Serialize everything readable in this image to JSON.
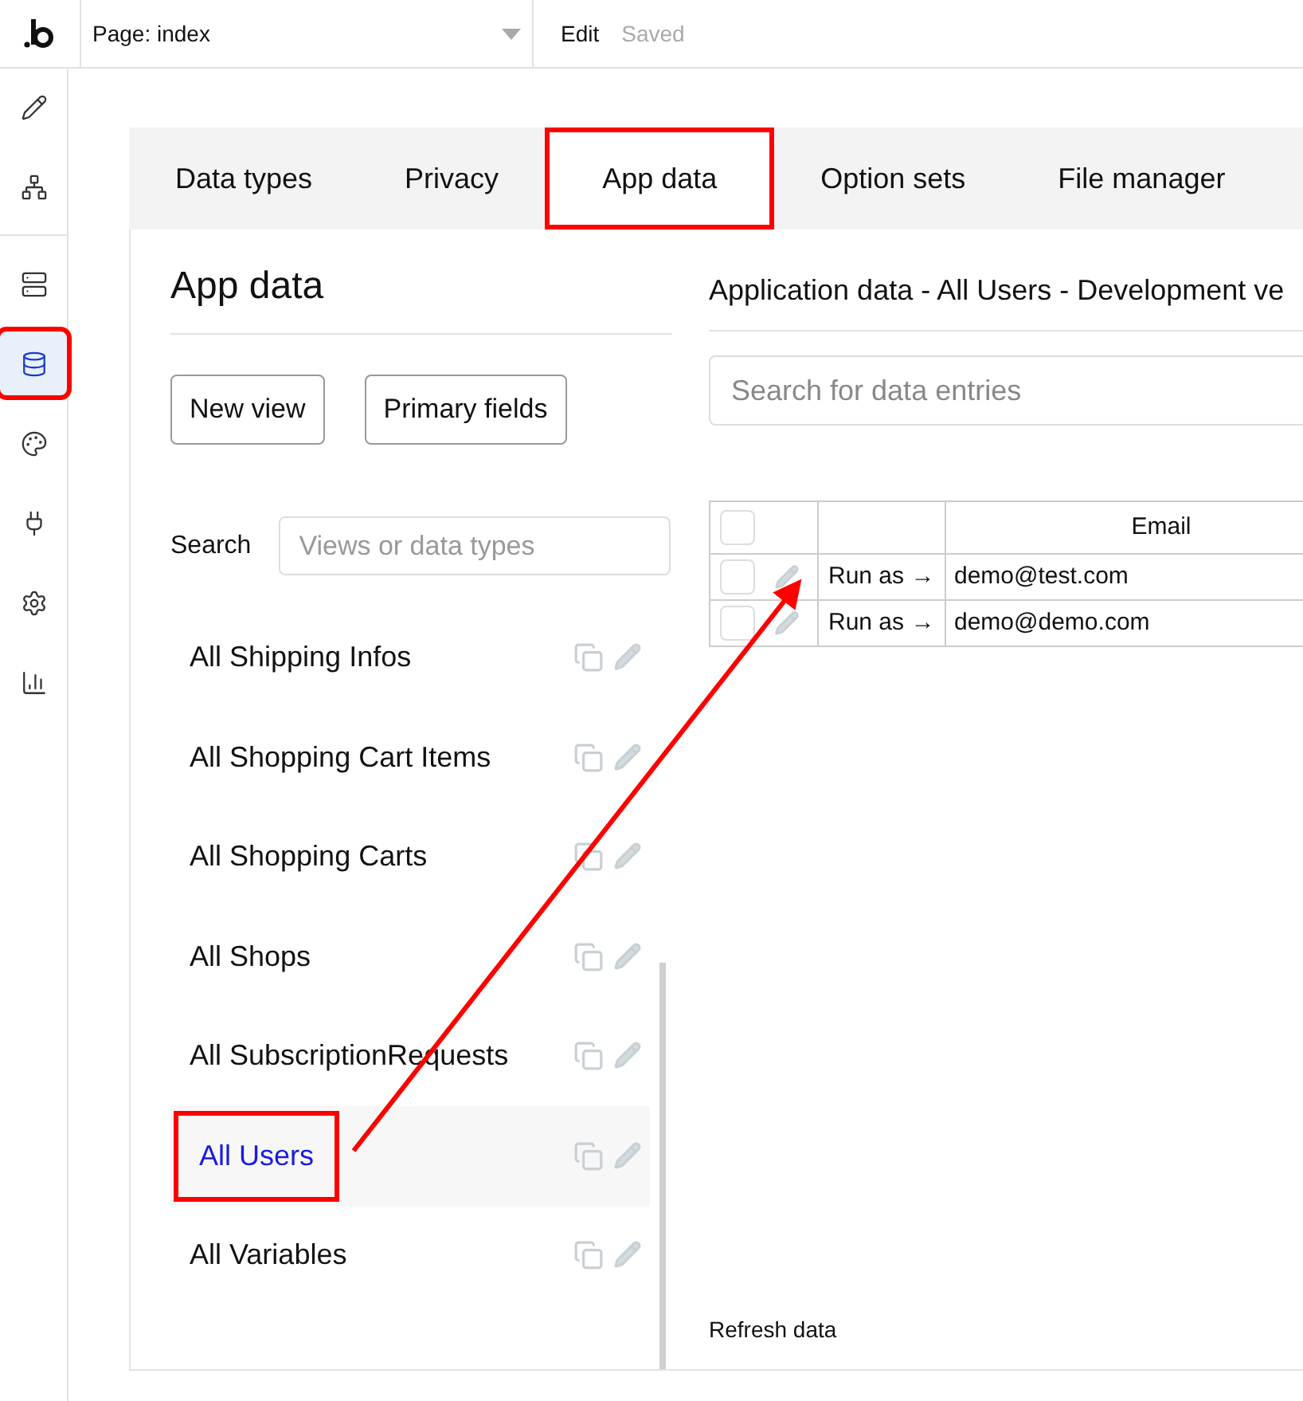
{
  "top_bar": {
    "page_select": "Page: index",
    "edit": "Edit",
    "saved": "Saved"
  },
  "sidebar": {
    "items": [
      {
        "kind": "pencil",
        "selected": false,
        "highlighted": false
      },
      {
        "kind": "tree",
        "selected": false,
        "highlighted": false
      },
      {
        "kind": "server",
        "selected": false,
        "highlighted": false
      },
      {
        "kind": "database",
        "selected": true,
        "highlighted": true
      },
      {
        "kind": "palette",
        "selected": false,
        "highlighted": false
      },
      {
        "kind": "plug",
        "selected": false,
        "highlighted": false
      },
      {
        "kind": "gear",
        "selected": false,
        "highlighted": false
      },
      {
        "kind": "chart",
        "selected": false,
        "highlighted": false
      }
    ]
  },
  "tabs": [
    {
      "label": "Data types",
      "selected": false,
      "highlighted": false
    },
    {
      "label": "Privacy",
      "selected": false,
      "highlighted": false
    },
    {
      "label": "App data",
      "selected": true,
      "highlighted": true
    },
    {
      "label": "Option sets",
      "selected": false,
      "highlighted": false
    },
    {
      "label": "File manager",
      "selected": false,
      "highlighted": false
    }
  ],
  "views_panel": {
    "title": "App data",
    "buttons": [
      "New view",
      "Primary fields"
    ],
    "search_label": "Search",
    "search_placeholder": "Views or data types",
    "items": [
      {
        "label": "All Shipping Infos",
        "selected": false
      },
      {
        "label": "All Shopping Cart Items",
        "selected": false
      },
      {
        "label": "All Shopping Carts",
        "selected": false
      },
      {
        "label": "All Shops",
        "selected": false
      },
      {
        "label": "All SubscriptionRequests",
        "selected": false
      },
      {
        "label": "All Users",
        "selected": true,
        "highlighted": true
      },
      {
        "label": "All Variables",
        "selected": false
      }
    ]
  },
  "data_panel": {
    "title": "Application data - All Users - Development ve",
    "search_placeholder": "Search for data entries",
    "table": {
      "all_checked": false,
      "columns": [
        "Email"
      ],
      "rows": [
        {
          "action": "Run as →",
          "email": "demo@test.com",
          "checked": false
        },
        {
          "action": "Run as →",
          "email": "demo@demo.com",
          "checked": false
        }
      ]
    },
    "refresh": "Refresh data"
  },
  "annotation": {
    "arrow": true
  }
}
